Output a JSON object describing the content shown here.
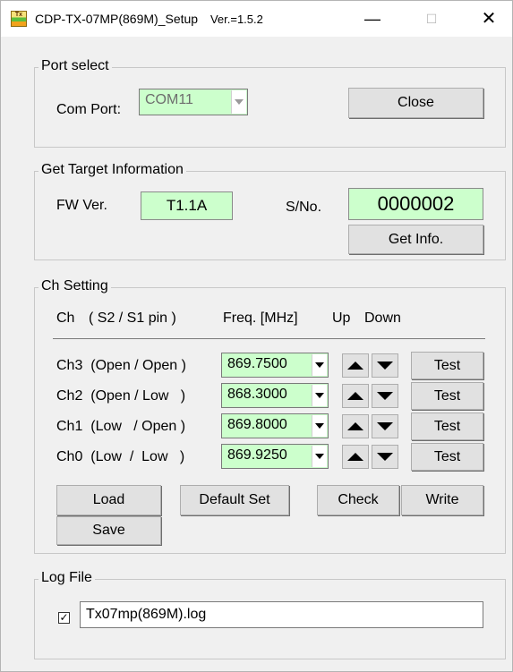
{
  "window": {
    "title": "CDP-TX-07MP(869M)_Setup",
    "version": "Ver.=1.5.2",
    "icon_text": "Tx",
    "min_symbol": "—",
    "max_symbol": "☐",
    "close_symbol": "✕"
  },
  "port_select": {
    "legend": "Port select",
    "com_label": "Com Port:",
    "com_value": "COM11",
    "close_label": "Close"
  },
  "target_info": {
    "legend": "Get Target Information",
    "fw_label": "FW Ver.",
    "fw_value": "T1.1A",
    "sn_label": "S/No.",
    "sn_value": "0000002",
    "get_info_label": "Get Info."
  },
  "ch_setting": {
    "legend": "Ch Setting",
    "header_ch": "Ch",
    "header_pins": "( S2 / S1 pin )",
    "header_freq": "Freq. [MHz]",
    "header_up": "Up",
    "header_down": "Down",
    "channels": [
      {
        "label": "Ch3  (Open / Open )",
        "freq": "869.7500",
        "test": "Test"
      },
      {
        "label": "Ch2  (Open / Low   )",
        "freq": "868.3000",
        "test": "Test"
      },
      {
        "label": "Ch1  (Low   / Open )",
        "freq": "869.8000",
        "test": "Test"
      },
      {
        "label": "Ch0  (Low  /  Low   )",
        "freq": "869.9250",
        "test": "Test"
      }
    ],
    "load_label": "Load",
    "default_label": "Default Set",
    "check_label": "Check",
    "write_label": "Write",
    "save_label": "Save"
  },
  "log_file": {
    "legend": "Log File",
    "checked": true,
    "check_mark": "✓",
    "filename": "Tx07mp(869M).log"
  },
  "colors": {
    "field_green": "#ccffcc",
    "window_bg": "#f0f0f0"
  }
}
